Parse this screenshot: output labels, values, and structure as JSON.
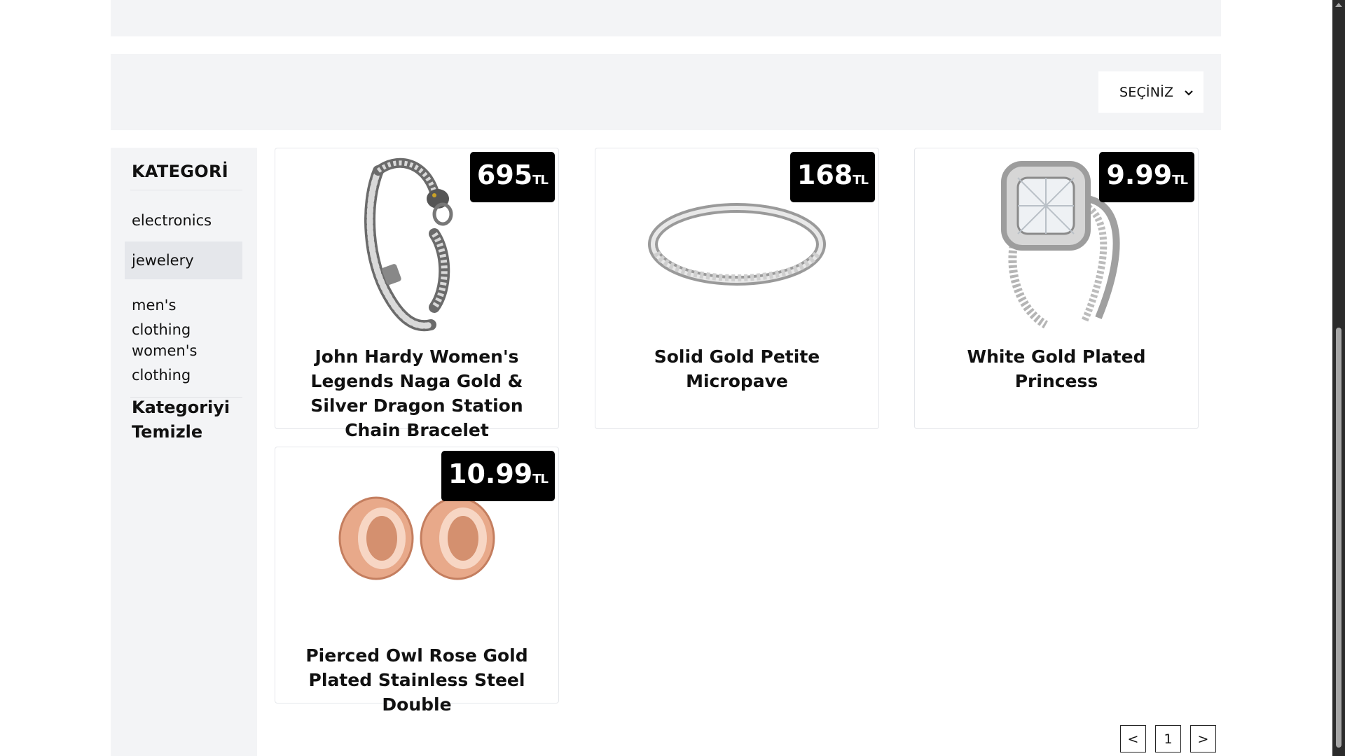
{
  "filter": {
    "sort_label": "SEÇİNİZ"
  },
  "sidebar": {
    "title": "KATEGORİ",
    "categories": [
      {
        "label": "electronics",
        "active": false
      },
      {
        "label": "jewelery",
        "active": true
      },
      {
        "label": "men's clothing",
        "active": false
      },
      {
        "label": "women's clothing",
        "active": false
      }
    ],
    "clear_label": "Kategoriyi Temizle"
  },
  "currency": "TL",
  "products": [
    {
      "title": "John Hardy Women's Legends Naga Gold & Silver Dragon Station Chain Bracelet",
      "price": "695",
      "image": "bracelet-image"
    },
    {
      "title": "Solid Gold Petite Micropave",
      "price": "168",
      "image": "ring-image"
    },
    {
      "title": "White Gold Plated Princess",
      "price": "9.99",
      "image": "diamond-ring-image"
    },
    {
      "title": "Pierced Owl Rose Gold Plated Stainless Steel Double",
      "price": "10.99",
      "image": "tunnel-plugs-image"
    }
  ],
  "pagination": {
    "prev": "<",
    "page": "1",
    "next": ">"
  },
  "colors": {
    "panel": "#f3f4f6",
    "active": "#e5e7eb",
    "price_bg": "#000000"
  }
}
